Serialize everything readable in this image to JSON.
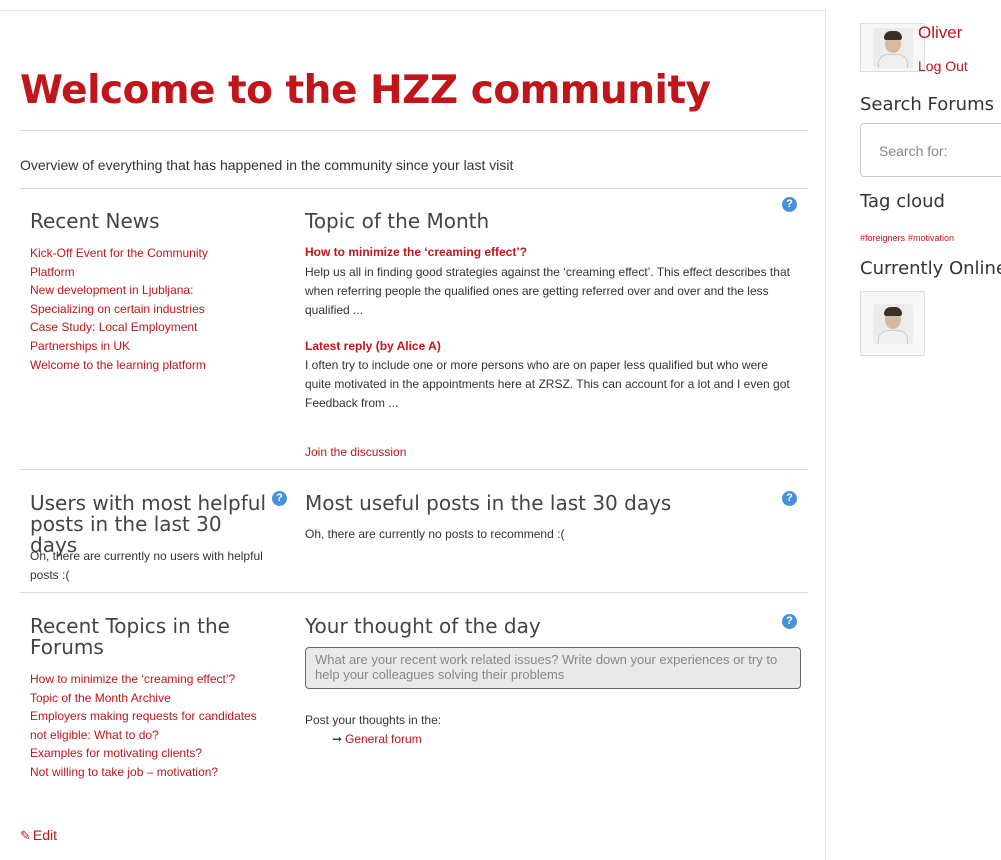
{
  "main": {
    "title": "Welcome to the HZZ community",
    "overview": "Overview of everything that has happened in the community since your last visit",
    "edit_label": "Edit",
    "recent_news": {
      "title": "Recent News",
      "items": [
        "Kick-Off Event for the Community Platform",
        "New development in Ljubljana: Specializing on certain industries",
        "Case Study: Local Employment Partnerships in UK",
        "Welcome to the learning platform"
      ]
    },
    "topic_of_month": {
      "title": "Topic of the Month",
      "topic_title": "How to minimize the ‘creaming effect’?",
      "topic_body": "Help us all in finding good strategies against the ‘creaming effect’. This effect describes that when referring people the qualified ones are getting referred over and over and the less qualified ...",
      "reply_title": "Latest reply (by Alice A)",
      "reply_body": "I often try to include one or more persons who are on paper less qualified but who were quite motivated in the appointments here at ZRSZ. This can account for a lot and I even got Feedback from ...",
      "join_link": "Join the discussion"
    },
    "helpful_users": {
      "title": "Users with most helpful posts in the last 30 days",
      "empty": "Oh, there are currently no users with helpful posts :("
    },
    "useful_posts": {
      "title": "Most useful posts in the last 30 days",
      "empty": "Oh, there are currently no posts to recommend :("
    },
    "recent_topics": {
      "title": "Recent Topics in the Forums",
      "items": [
        "How to minimize the ‘creaming effect’?",
        "Topic of the Month Archive",
        "Employers making requests for candidates not eligible: What to do?",
        "Examples for motivating clients?",
        "Not willing to take job – motivation?"
      ]
    },
    "thought": {
      "title": "Your thought of the day",
      "placeholder": "What are your recent work related issues? Write down your experiences or try to help your colleagues solving their problems",
      "post_label": "Post your thoughts in the:",
      "forum_link": "General forum",
      "arrow": "➞"
    },
    "help_glyph": "?"
  },
  "sidebar": {
    "user_name": "Oliver",
    "logout": "Log Out",
    "search_heading": "Search Forums",
    "search_placeholder": "Search for:",
    "tag_heading": "Tag cloud",
    "tags": [
      "#foreigners",
      "#motivation"
    ],
    "online_heading": "Currently Online"
  },
  "colors": {
    "accent": "#c0151b",
    "help": "#4a90d9"
  }
}
